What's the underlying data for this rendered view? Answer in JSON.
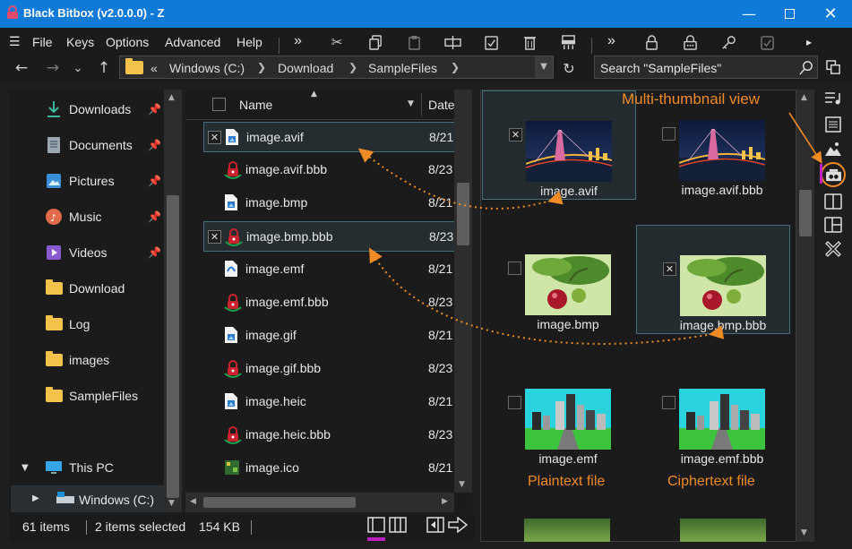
{
  "window": {
    "title": "Black Bitbox (v2.0.0.0) - Z",
    "minimize_icon": "minimize-icon",
    "maximize_icon": "maximize-icon",
    "close_icon": "close-icon"
  },
  "menu": {
    "hamburger": "☰",
    "items": [
      "File",
      "Keys",
      "Options",
      "Advanced",
      "Help"
    ],
    "overflow": "»"
  },
  "address": {
    "overflow": "«",
    "crumbs": [
      "Windows (C:)",
      "Download",
      "SampleFiles"
    ],
    "search_placeholder": "Search \"SampleFiles\""
  },
  "nav": {
    "items": [
      {
        "label": "Downloads",
        "icon": "download-arrow-icon",
        "pinned": true
      },
      {
        "label": "Documents",
        "icon": "documents-icon",
        "pinned": true
      },
      {
        "label": "Pictures",
        "icon": "pictures-icon",
        "pinned": true
      },
      {
        "label": "Music",
        "icon": "music-icon",
        "pinned": true
      },
      {
        "label": "Videos",
        "icon": "videos-icon",
        "pinned": true
      },
      {
        "label": "Download",
        "icon": "folder-icon",
        "pinned": false
      },
      {
        "label": "Log",
        "icon": "folder-icon",
        "pinned": false
      },
      {
        "label": "images",
        "icon": "folder-icon",
        "pinned": false
      },
      {
        "label": "SampleFiles",
        "icon": "folder-icon",
        "pinned": false
      }
    ],
    "this_pc": "This PC",
    "drive": "Windows (C:)"
  },
  "filelist": {
    "col_name": "Name",
    "col_date": "Date",
    "rows": [
      {
        "name": "image.avif",
        "date": "8/21",
        "type": "image",
        "selected": true
      },
      {
        "name": "image.avif.bbb",
        "date": "8/23",
        "type": "bbb",
        "selected": false
      },
      {
        "name": "image.bmp",
        "date": "8/21",
        "type": "image",
        "selected": false
      },
      {
        "name": "image.bmp.bbb",
        "date": "8/23",
        "type": "bbb",
        "selected": true
      },
      {
        "name": "image.emf",
        "date": "8/21",
        "type": "emf",
        "selected": false
      },
      {
        "name": "image.emf.bbb",
        "date": "8/23",
        "type": "bbb",
        "selected": false
      },
      {
        "name": "image.gif",
        "date": "8/21",
        "type": "image",
        "selected": false
      },
      {
        "name": "image.gif.bbb",
        "date": "8/23",
        "type": "bbb",
        "selected": false
      },
      {
        "name": "image.heic",
        "date": "8/21",
        "type": "image",
        "selected": false
      },
      {
        "name": "image.heic.bbb",
        "date": "8/23",
        "type": "bbb",
        "selected": false
      },
      {
        "name": "image.ico",
        "date": "8/21",
        "type": "ico",
        "selected": false
      }
    ]
  },
  "status": {
    "count": "61 items",
    "selected": "2 items selected",
    "size": "154 KB"
  },
  "preview": {
    "annotation_view": "Multi-thumbnail view",
    "annotation_plain": "Plaintext file",
    "annotation_cipher": "Ciphertext file",
    "thumbs": [
      {
        "name": "image.avif",
        "kind": "bridge",
        "checked": true,
        "selected": true
      },
      {
        "name": "image.avif.bbb",
        "kind": "bridge",
        "checked": false,
        "selected": false
      },
      {
        "name": "image.bmp",
        "kind": "cherry",
        "checked": false,
        "selected": false
      },
      {
        "name": "image.bmp.bbb",
        "kind": "cherry",
        "checked": true,
        "selected": true
      },
      {
        "name": "image.emf",
        "kind": "city",
        "checked": false,
        "selected": false
      },
      {
        "name": "image.emf.bbb",
        "kind": "city",
        "checked": false,
        "selected": false
      }
    ]
  },
  "colors": {
    "titlebar": "#0f7ad8",
    "accent": "#f08a24",
    "selection_border": "#446e7c",
    "lock_red": "#c8242f",
    "lock_green": "#19a24a"
  }
}
